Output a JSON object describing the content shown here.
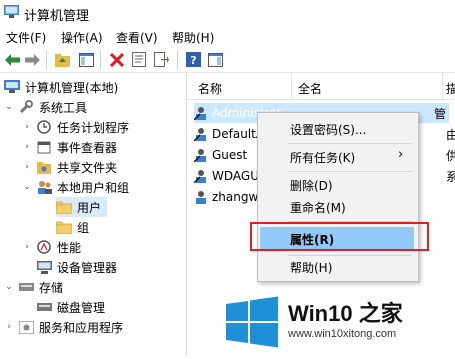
{
  "window": {
    "title": "计算机管理"
  },
  "menu": [
    "文件(F)",
    "操作(A)",
    "查看(V)",
    "帮助(H)"
  ],
  "tree": {
    "root": "计算机管理(本地)",
    "items": [
      {
        "label": "系统工具"
      },
      {
        "label": "任务计划程序"
      },
      {
        "label": "事件查看器"
      },
      {
        "label": "共享文件夹"
      },
      {
        "label": "本地用户和组"
      },
      {
        "label": "用户"
      },
      {
        "label": "组"
      },
      {
        "label": "性能"
      },
      {
        "label": "设备管理器"
      },
      {
        "label": "存储"
      },
      {
        "label": "磁盘管理"
      },
      {
        "label": "服务和应用程序"
      }
    ]
  },
  "list": {
    "columns": [
      "名称",
      "全名",
      "描"
    ],
    "rows": [
      {
        "name": "Administrat",
        "extra": "管"
      },
      {
        "name": "DefaultA",
        "extra": "由"
      },
      {
        "name": "Guest",
        "extra": "供"
      },
      {
        "name": "WDAGU",
        "extra": "系"
      },
      {
        "name": "zhangw",
        "extra": ""
      }
    ]
  },
  "context_menu": {
    "items": [
      "设置密码(S)...",
      "所有任务(K)",
      "删除(D)",
      "重命名(M)",
      "属性(R)",
      "帮助(H)"
    ]
  },
  "watermark": {
    "brand": "Win10 之家",
    "url": "www.win10xitong.com"
  },
  "colors": {
    "highlight": "#91c9f7",
    "red_box": "#e02020",
    "win_blue": "#1e90d8"
  }
}
